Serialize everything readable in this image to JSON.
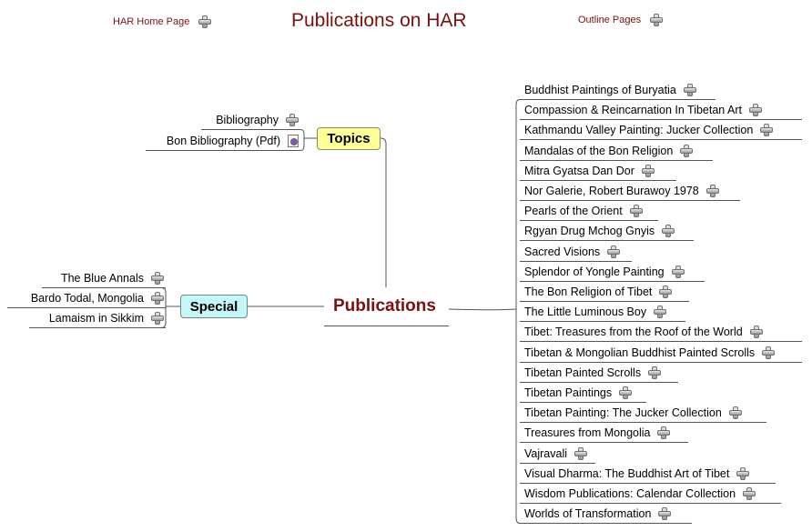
{
  "header": {
    "home_label": "HAR Home Page",
    "title": "Publications on HAR",
    "outline_label": "Outline Pages"
  },
  "central": {
    "label": "Publications"
  },
  "topics": {
    "label": "Topics",
    "items": [
      {
        "label": "Bibliography",
        "icon": "plus-icon"
      },
      {
        "label": "Bon Bibliography (Pdf)",
        "icon": "pdf-document-icon"
      }
    ]
  },
  "special": {
    "label": "Special",
    "items": [
      {
        "label": "The Blue Annals"
      },
      {
        "label": "Bardo Todal, Mongolia"
      },
      {
        "label": "Lamaism in Sikkim"
      }
    ]
  },
  "publications": [
    {
      "label": "Buddhist Paintings of Buryatia"
    },
    {
      "label": "Compassion & Reincarnation In Tibetan Art"
    },
    {
      "label": "Kathmandu Valley Painting: Jucker Collection"
    },
    {
      "label": "Mandalas of the Bon Religion"
    },
    {
      "label": "Mitra Gyatsa Dan Dor"
    },
    {
      "label": "Nor Galerie, Robert Burawoy 1978"
    },
    {
      "label": "Pearls of the Orient"
    },
    {
      "label": "Rgyan Drug Mchog Gnyis"
    },
    {
      "label": "Sacred Visions"
    },
    {
      "label": "Splendor of Yongle Painting"
    },
    {
      "label": "The Bon Religion of Tibet"
    },
    {
      "label": "The Little Luminous Boy"
    },
    {
      "label": "Tibet: Treasures from the Roof of the World"
    },
    {
      "label": "Tibetan & Mongolian Buddhist Painted Scrolls"
    },
    {
      "label": "Tibetan Painted Scrolls"
    },
    {
      "label": "Tibetan Paintings"
    },
    {
      "label": "Tibetan Painting: The Jucker Collection"
    },
    {
      "label": "Treasures from Mongolia"
    },
    {
      "label": "Vajravali"
    },
    {
      "label": "Visual Dharma: The Buddhist Art of Tibet"
    },
    {
      "label": "Wisdom Publications: Calendar Collection"
    },
    {
      "label": "Worlds of Transformation"
    }
  ],
  "colors": {
    "title": "#7a1010",
    "topic_fill": "#ffff99",
    "special_fill": "#c6f6f8",
    "connector": "#555555"
  }
}
